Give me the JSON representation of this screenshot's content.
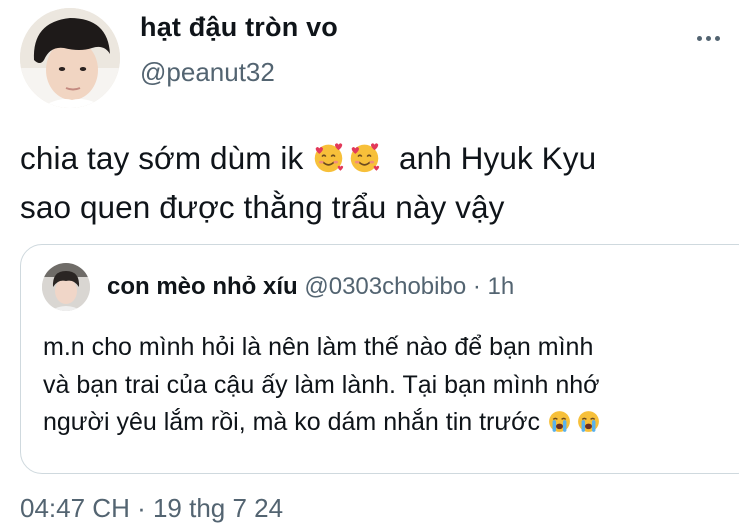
{
  "author": {
    "display_name": "hạt đậu tròn vo",
    "handle": "@peanut32"
  },
  "tweet": {
    "lines": [
      {
        "before": "chia tay sớm dùm ik ",
        "emojis": [
          "smiling-face-with-hearts",
          "smiling-face-with-hearts"
        ],
        "after": "  anh Hyuk Kyu"
      },
      {
        "text": "sao quen được thằng trẩu này vậy"
      }
    ]
  },
  "quoted_tweet": {
    "display_name": "con mèo nhỏ xíu",
    "handle": "@0303chobibo",
    "separator": " · ",
    "time": "1h",
    "lines": [
      "m.n cho mình hỏi là nên làm thế nào để bạn mình",
      "và bạn trai của cậu ấy làm lành. Tại bạn mình nhớ",
      "người yêu lắm rồi, mà ko dám nhắn tin trước "
    ],
    "trailing_emojis": [
      "loudly-crying-face",
      "loudly-crying-face"
    ]
  },
  "timestamp": "04:47 CH · 19 thg 7 24",
  "icons": {
    "more": "more-horizontal-icon"
  },
  "colors": {
    "text_primary": "#0f1419",
    "text_secondary": "#536471",
    "border": "#cfd9de",
    "emoji_yellow": "#f7c03a",
    "heart_red": "#e2395a",
    "tear_blue": "#5ab2ec"
  }
}
